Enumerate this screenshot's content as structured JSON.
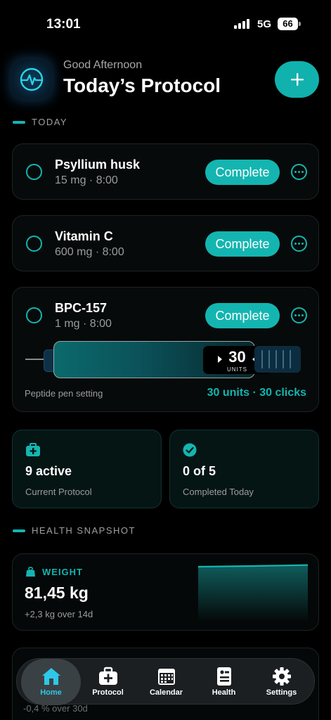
{
  "status_bar": {
    "time": "13:01",
    "network": "5G",
    "battery": "66"
  },
  "header": {
    "greeting": "Good Afternoon",
    "title": "Today’s Protocol"
  },
  "sections": {
    "today": "TODAY",
    "health": "HEALTH SNAPSHOT"
  },
  "medications": [
    {
      "name": "Psyllium husk",
      "detail": "15 mg · 8:00",
      "action": "Complete"
    },
    {
      "name": "Vitamin C",
      "detail": "600 mg · 8:00",
      "action": "Complete"
    },
    {
      "name": "BPC-157",
      "detail": "1 mg · 8:00",
      "action": "Complete"
    }
  ],
  "pen": {
    "units_value": "30",
    "units_label": "UNITS",
    "label": "Peptide pen setting",
    "value": "30 units · 30 clicks"
  },
  "stats": [
    {
      "value": "9 active",
      "label": "Current Protocol",
      "icon": "medkit-icon"
    },
    {
      "value": "0 of 5",
      "label": "Completed Today",
      "icon": "check-circle-icon"
    }
  ],
  "weight": {
    "label": "WEIGHT",
    "value": "81,45 kg",
    "change": "+2,3 kg over 14d",
    "icon": "scale-icon"
  },
  "behind_card": {
    "change": "-0,4 % over 30d"
  },
  "tabs": [
    {
      "label": "Home",
      "icon": "home-icon",
      "active": true
    },
    {
      "label": "Protocol",
      "icon": "medkit-icon",
      "active": false
    },
    {
      "label": "Calendar",
      "icon": "calendar-icon",
      "active": false
    },
    {
      "label": "Health",
      "icon": "health-record-icon",
      "active": false
    },
    {
      "label": "Settings",
      "icon": "gear-icon",
      "active": false
    }
  ],
  "colors": {
    "accent": "#14b5b0",
    "background": "#000000",
    "active_tab": "#2fc7e8"
  }
}
